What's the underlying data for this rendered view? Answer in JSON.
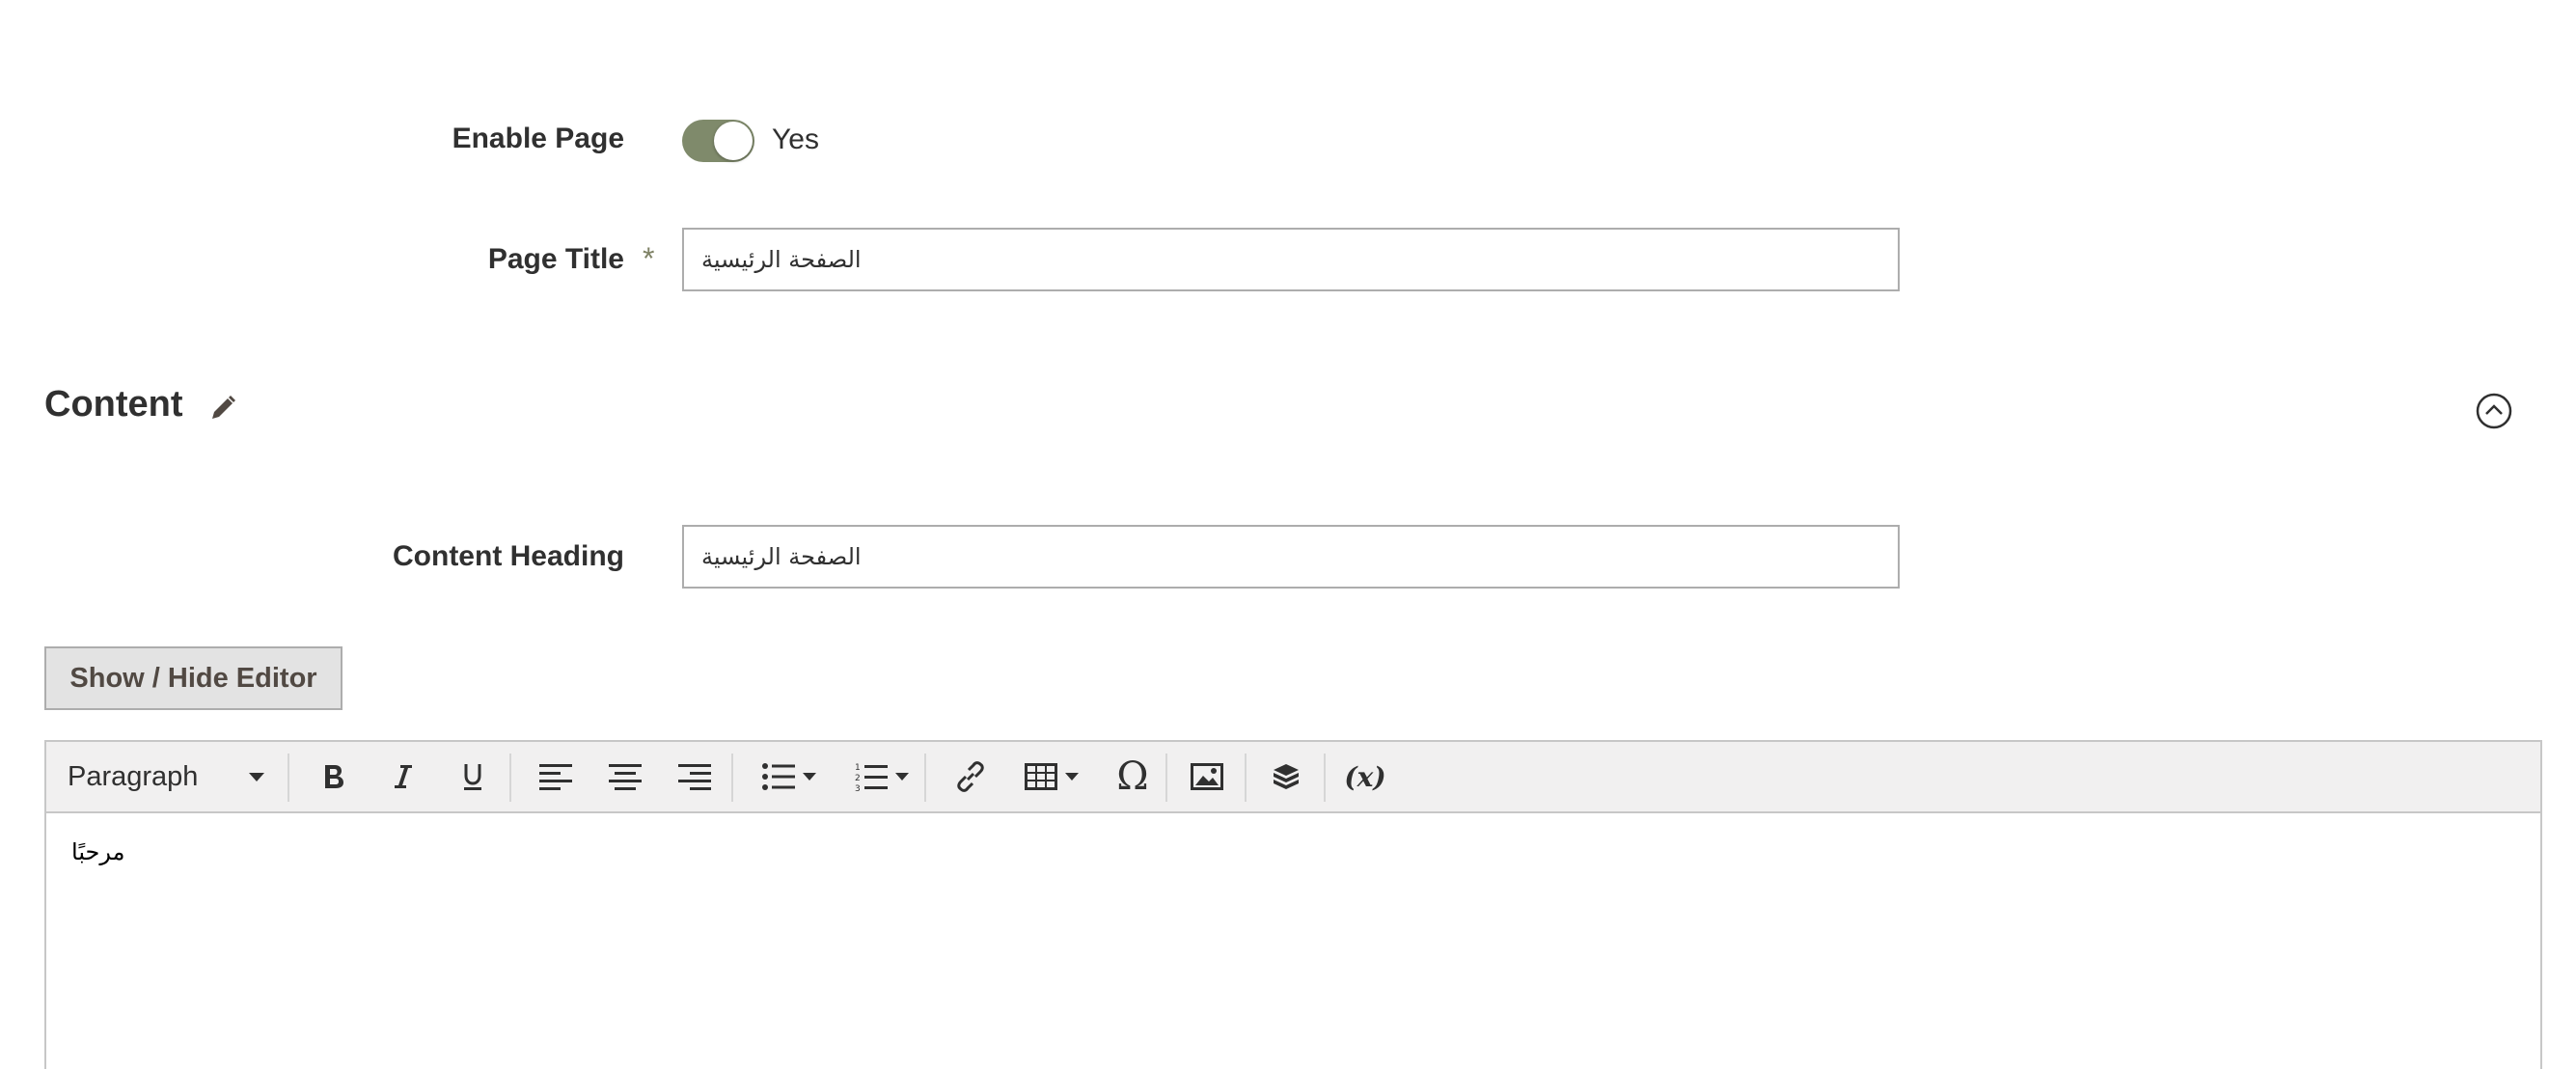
{
  "enable_page": {
    "label": "Enable Page",
    "value_text": "Yes",
    "enabled": true
  },
  "page_title": {
    "label": "Page Title",
    "required_marker": "*",
    "value": "الصفحة الرئيسية"
  },
  "content_section": {
    "title": "Content"
  },
  "content_heading": {
    "label": "Content Heading",
    "value": "الصفحة الرئيسية"
  },
  "editor_toggle": {
    "label": "Show / Hide Editor"
  },
  "editor": {
    "format_select": "Paragraph",
    "body_text": "مرحبًا",
    "toolbar_icons": [
      "bold-icon",
      "italic-icon",
      "underline-icon",
      "align-left-icon",
      "align-center-icon",
      "align-right-icon",
      "bulleted-list-icon",
      "numbered-list-icon",
      "link-icon",
      "table-icon",
      "special-character-icon",
      "insert-image-icon",
      "insert-widget-icon",
      "insert-variable-icon"
    ],
    "variable_icon_text": "(x)",
    "omega_text": "Ω"
  },
  "colors": {
    "toggle_on": "#7f8a6b",
    "required_star": "#7f8266",
    "toolbar_bg": "#f1f0f0",
    "button_bg": "#e3e3e3"
  }
}
